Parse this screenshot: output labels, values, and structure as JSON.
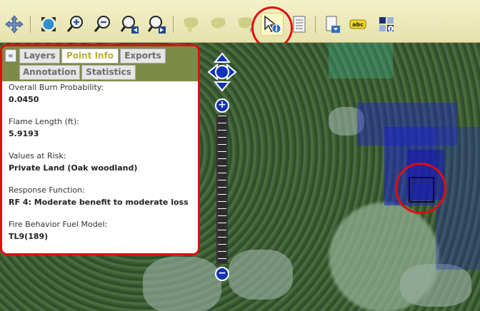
{
  "toolbar": {
    "tools": [
      {
        "name": "pan-icon"
      },
      {
        "name": "full-extent-icon"
      },
      {
        "name": "zoom-in-icon"
      },
      {
        "name": "zoom-out-icon"
      },
      {
        "name": "previous-extent-icon"
      },
      {
        "name": "next-extent-icon"
      },
      {
        "name": "select-point-icon"
      },
      {
        "name": "select-area-icon"
      },
      {
        "name": "select-polygon-icon"
      },
      {
        "name": "identify-icon",
        "active": true
      },
      {
        "name": "list-icon"
      },
      {
        "name": "export-icon"
      },
      {
        "name": "labels-icon",
        "text": "abc"
      },
      {
        "name": "legend-icon"
      }
    ]
  },
  "tabs": {
    "collapse": "«",
    "layers": "Layers",
    "point_info": "Point Info",
    "exports": "Exports",
    "annotation": "Annotation",
    "statistics": "Statistics"
  },
  "info": [
    {
      "label": "Overall Burn Probability:",
      "value": "0.0450"
    },
    {
      "label": "Flame Length (ft):",
      "value": "5.9193"
    },
    {
      "label": "Values at Risk:",
      "value": "Private Land (Oak woodland)"
    },
    {
      "label": "Response Function:",
      "value": "RF 4: Moderate benefit to moderate loss"
    },
    {
      "label": "Fire Behavior Fuel Model:",
      "value": "TL9(189)"
    }
  ],
  "zoom": {
    "plus": "+",
    "minus": "−"
  },
  "colors": {
    "highlight": "#e10d0d",
    "overlay": "#1e24c8",
    "nav": "#1233b4"
  }
}
